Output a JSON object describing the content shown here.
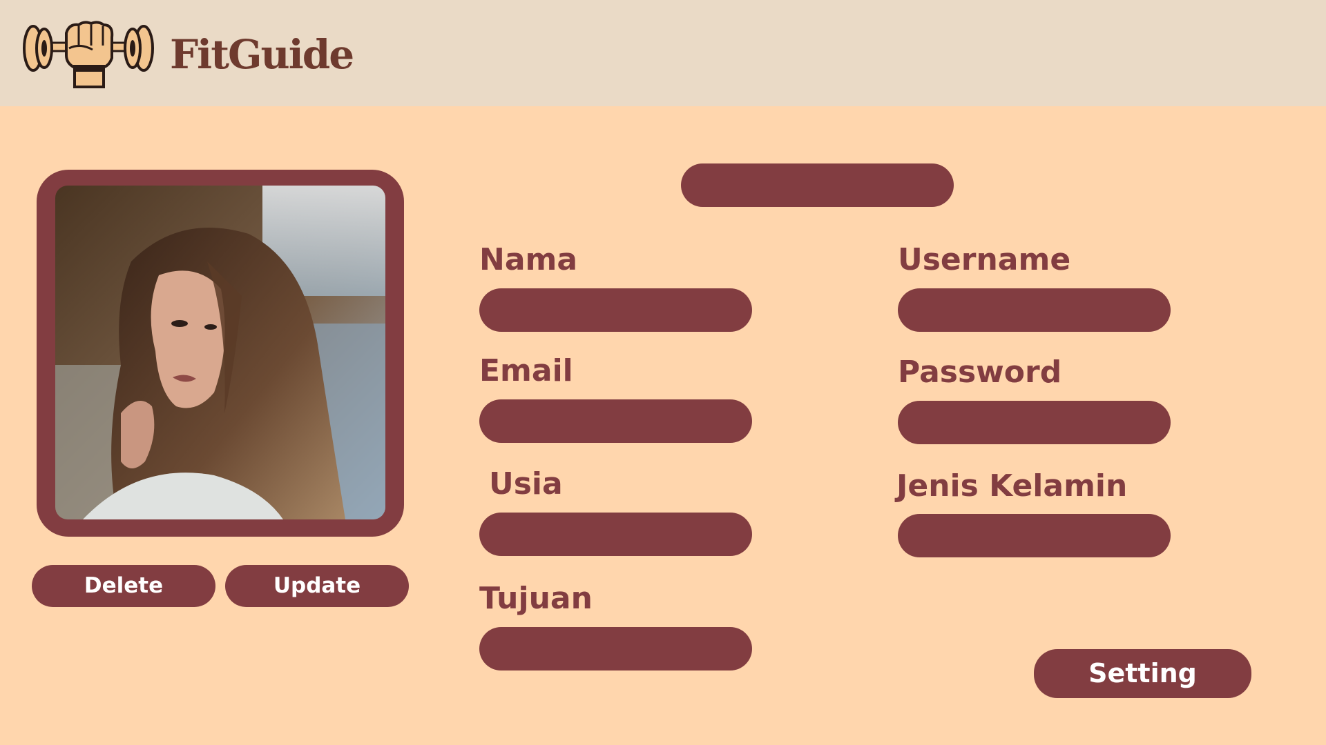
{
  "header": {
    "brand": "FitGuide",
    "logo_icon": "fist-dumbbell-logo-icon"
  },
  "profile": {
    "photo_icon": "profile-photo-image",
    "delete_label": "Delete",
    "update_label": "Update"
  },
  "form": {
    "fields": [
      {
        "label": "Nama",
        "value": ""
      },
      {
        "label": "Username",
        "value": ""
      },
      {
        "label": "Email",
        "value": ""
      },
      {
        "label": "Password",
        "value": ""
      },
      {
        "label": "Usia",
        "value": ""
      },
      {
        "label": "Jenis Kelamin",
        "value": ""
      },
      {
        "label": "Tujuan",
        "value": ""
      }
    ],
    "setting_label": "Setting"
  },
  "colors": {
    "header_bg": "#eadac6",
    "page_bg": "#ffd6ad",
    "accent": "#823d41",
    "brand_text": "#6e3a2e",
    "button_text": "#ffffff"
  }
}
